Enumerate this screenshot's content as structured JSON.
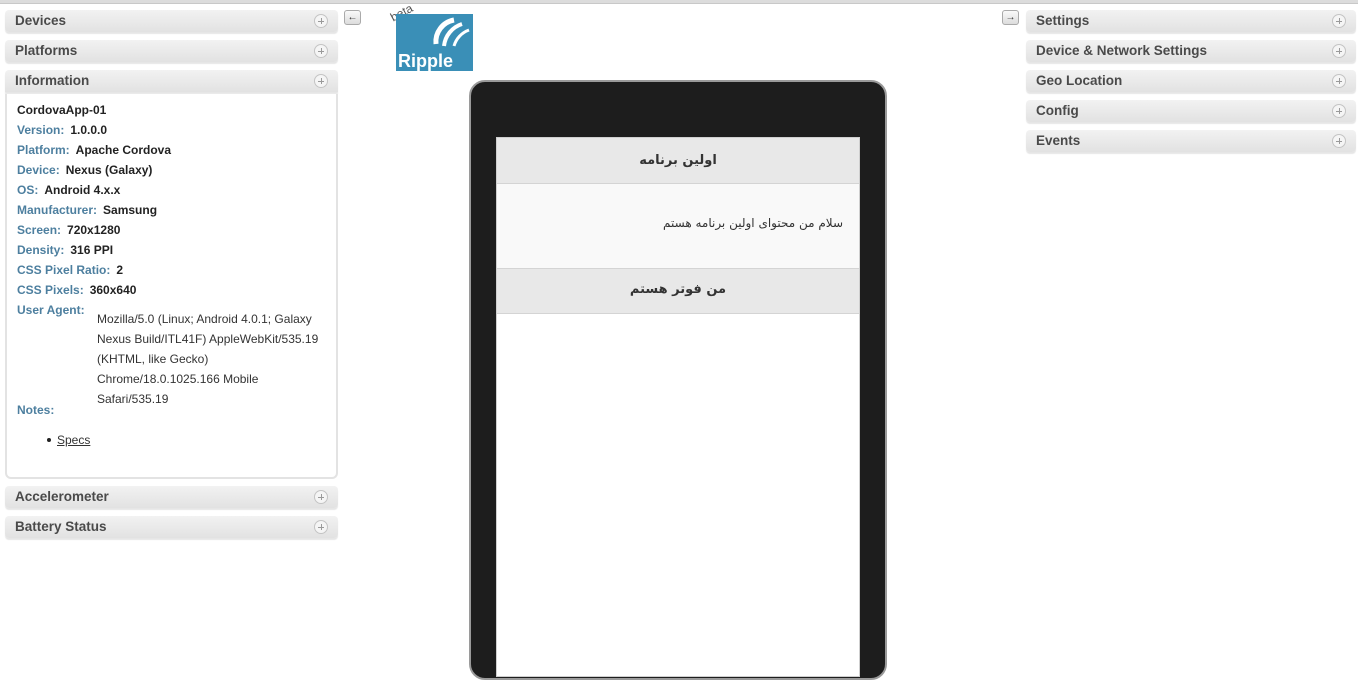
{
  "left_panels": {
    "devices": "Devices",
    "platforms": "Platforms",
    "information": "Information",
    "accelerometer": "Accelerometer",
    "battery_status": "Battery Status"
  },
  "information": {
    "app_name": "CordovaApp-01",
    "rows": [
      {
        "key": "Version:",
        "value": "1.0.0.0"
      },
      {
        "key": "Platform:",
        "value": "Apache Cordova"
      },
      {
        "key": "Device:",
        "value": "Nexus (Galaxy)"
      },
      {
        "key": "OS:",
        "value": "Android 4.x.x"
      },
      {
        "key": "Manufacturer:",
        "value": "Samsung"
      },
      {
        "key": "Screen:",
        "value": "720x1280"
      },
      {
        "key": "Density:",
        "value": "316 PPI"
      },
      {
        "key": "CSS Pixel Ratio:",
        "value": "2"
      },
      {
        "key": "CSS Pixels:",
        "value": "360x640"
      }
    ],
    "user_agent_label": "User Agent:",
    "user_agent_lines": [
      "Mozilla/5.0 (Linux; Android 4.0.1; Galaxy",
      "Nexus Build/ITL41F) AppleWebKit/535.19",
      "(KHTML, like Gecko)",
      "Chrome/18.0.1025.166 Mobile",
      "Safari/535.19"
    ],
    "notes_label": "Notes:",
    "specs_link": "Specs"
  },
  "right_panels": {
    "settings": "Settings",
    "device_network": "Device & Network Settings",
    "geo_location": "Geo Location",
    "config": "Config",
    "events": "Events"
  },
  "logo": {
    "beta": "beta",
    "text": "Ripple",
    "color": "#3a8fb7"
  },
  "app": {
    "header": "اولین برنامه",
    "content": "سلام من محتوای اولین برنامه هستم",
    "footer": "من فوتر هستم"
  },
  "icons": {
    "collapse_left": "arrow-left-icon",
    "collapse_right": "arrow-right-icon",
    "panel_toggle": "plus-circle-icon"
  }
}
